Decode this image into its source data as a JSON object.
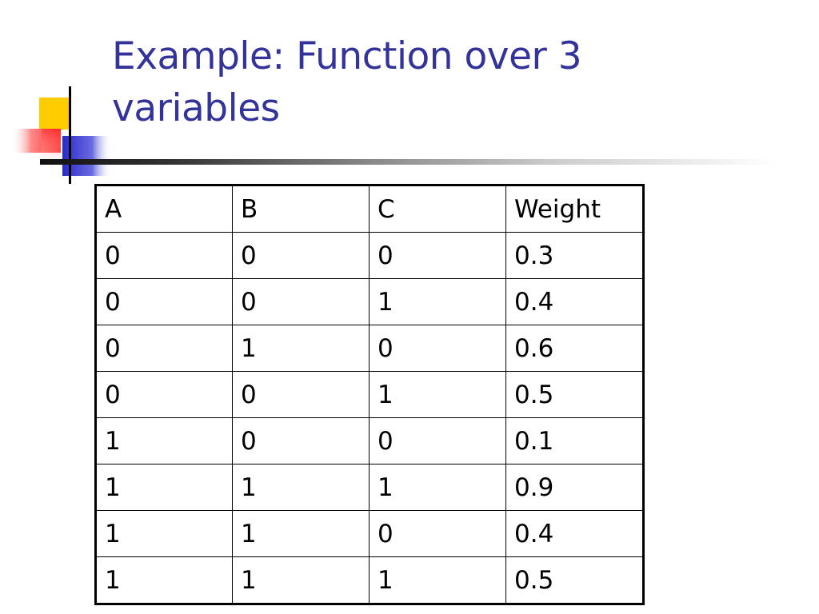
{
  "slide": {
    "title_line1": "Example: Function over 3",
    "title_line2": "variables"
  },
  "logo": {
    "icon": "decorative-squares-logo",
    "colors": {
      "yellow": "#ffcc00",
      "red": "#ff3333",
      "blue": "#3333cc",
      "line": "#000000"
    }
  },
  "title_color": "#333399",
  "table": {
    "headers": [
      "A",
      "B",
      "C",
      "Weight"
    ],
    "rows": [
      [
        "0",
        "0",
        "0",
        "0.3"
      ],
      [
        "0",
        "0",
        "1",
        "0.4"
      ],
      [
        "0",
        "1",
        "0",
        "0.6"
      ],
      [
        "0",
        "0",
        "1",
        "0.5"
      ],
      [
        "1",
        "0",
        "0",
        "0.1"
      ],
      [
        "1",
        "1",
        "1",
        "0.9"
      ],
      [
        "1",
        "1",
        "0",
        "0.4"
      ],
      [
        "1",
        "1",
        "1",
        "0.5"
      ]
    ]
  }
}
